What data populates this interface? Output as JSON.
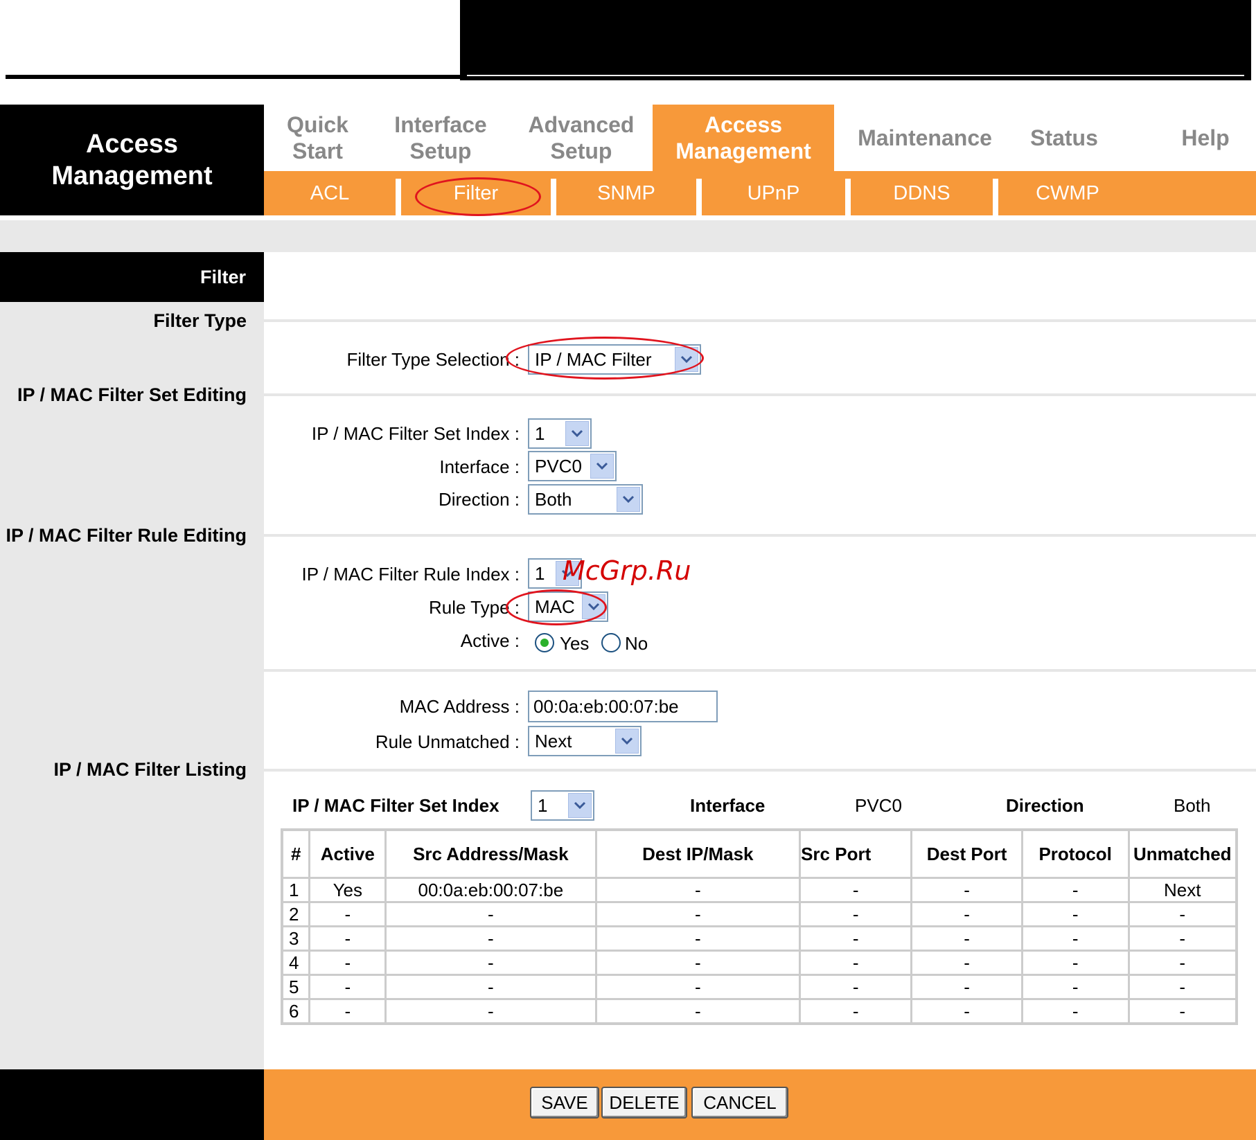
{
  "header": {
    "section_title_line1": "Access",
    "section_title_line2": "Management"
  },
  "main_tabs": [
    {
      "line1": "Quick",
      "line2": "Start"
    },
    {
      "line1": "Interface",
      "line2": "Setup"
    },
    {
      "line1": "Advanced",
      "line2": "Setup"
    },
    {
      "line1": "Access",
      "line2": "Management"
    },
    {
      "line1": "Maintenance",
      "line2": ""
    },
    {
      "line1": "Status",
      "line2": ""
    },
    {
      "line1": "Help",
      "line2": ""
    }
  ],
  "sub_tabs": [
    "ACL",
    "Filter",
    "SNMP",
    "UPnP",
    "DDNS",
    "CWMP"
  ],
  "sections": {
    "filter": "Filter",
    "filter_type": "Filter Type",
    "set_editing": "IP / MAC Filter Set Editing",
    "rule_editing": "IP / MAC Filter Rule Editing",
    "listing": "IP / MAC Filter Listing"
  },
  "form": {
    "filter_type_label": "Filter Type Selection :",
    "filter_type_value": "IP / MAC Filter",
    "set_index_label": "IP / MAC Filter Set Index :",
    "set_index_value": "1",
    "interface_label": "Interface :",
    "interface_value": "PVC0",
    "direction_label": "Direction :",
    "direction_value": "Both",
    "rule_index_label": "IP / MAC Filter Rule Index :",
    "rule_index_value": "1",
    "rule_type_label": "Rule Type :",
    "rule_type_value": "MAC",
    "active_label": "Active :",
    "active_yes": "Yes",
    "active_no": "No",
    "mac_label": "MAC Address :",
    "mac_value": "00:0a:eb:00:07:be",
    "unmatched_label": "Rule Unmatched :",
    "unmatched_value": "Next"
  },
  "listing": {
    "set_index_label": "IP / MAC Filter Set Index",
    "set_index_value": "1",
    "interface_label": "Interface",
    "interface_value": "PVC0",
    "direction_label": "Direction",
    "direction_value": "Both",
    "columns": [
      "#",
      "Active",
      "Src Address/Mask",
      "Dest IP/Mask",
      "Src Port",
      "Dest Port",
      "Protocol",
      "Unmatched"
    ],
    "rows": [
      [
        "1",
        "Yes",
        "00:0a:eb:00:07:be",
        "-",
        "-",
        "-",
        "-",
        "Next"
      ],
      [
        "2",
        "-",
        "-",
        "-",
        "-",
        "-",
        "-",
        "-"
      ],
      [
        "3",
        "-",
        "-",
        "-",
        "-",
        "-",
        "-",
        "-"
      ],
      [
        "4",
        "-",
        "-",
        "-",
        "-",
        "-",
        "-",
        "-"
      ],
      [
        "5",
        "-",
        "-",
        "-",
        "-",
        "-",
        "-",
        "-"
      ],
      [
        "6",
        "-",
        "-",
        "-",
        "-",
        "-",
        "-",
        "-"
      ]
    ]
  },
  "buttons": {
    "save": "SAVE",
    "delete": "DELETE",
    "cancel": "CANCEL"
  },
  "watermark": "McGrp.Ru",
  "colors": {
    "accent": "#f7993a",
    "header_bg": "#000000",
    "panel_gray": "#e8e8e8",
    "highlight_ring": "#e0141e"
  }
}
